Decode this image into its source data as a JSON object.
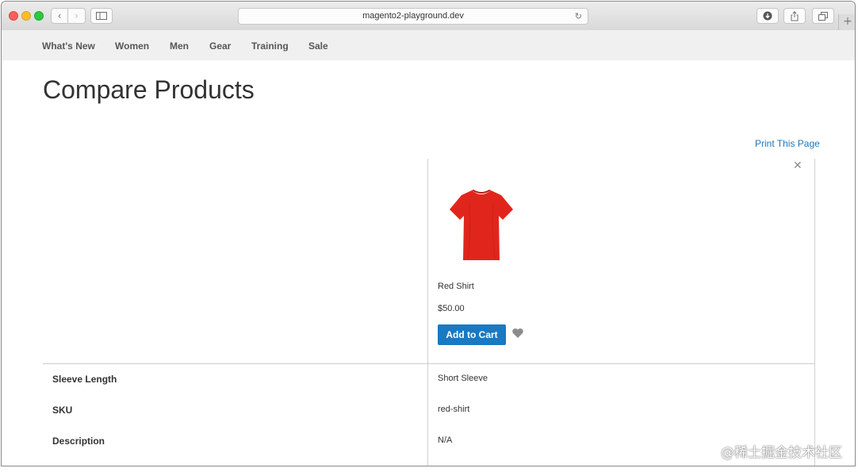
{
  "browser": {
    "url": "magento2-playground.dev",
    "reload_icon": "reload-icon",
    "new_tab_icon": "plus-icon"
  },
  "nav": {
    "items": [
      {
        "label": "What's New"
      },
      {
        "label": "Women"
      },
      {
        "label": "Men"
      },
      {
        "label": "Gear"
      },
      {
        "label": "Training"
      },
      {
        "label": "Sale"
      }
    ]
  },
  "page": {
    "title": "Compare Products",
    "print_label": "Print This Page"
  },
  "product": {
    "name": "Red Shirt",
    "price": "$50.00",
    "add_to_cart_label": "Add to Cart",
    "image_color": "#e0261c"
  },
  "attributes": [
    {
      "label": "Sleeve Length",
      "value": "Short Sleeve"
    },
    {
      "label": "SKU",
      "value": "red-shirt"
    },
    {
      "label": "Description",
      "value": "N/A"
    }
  ],
  "colors": {
    "accent": "#1979c3",
    "nav_bg": "#f0f0f0"
  },
  "watermark": "@稀土掘金技术社区"
}
